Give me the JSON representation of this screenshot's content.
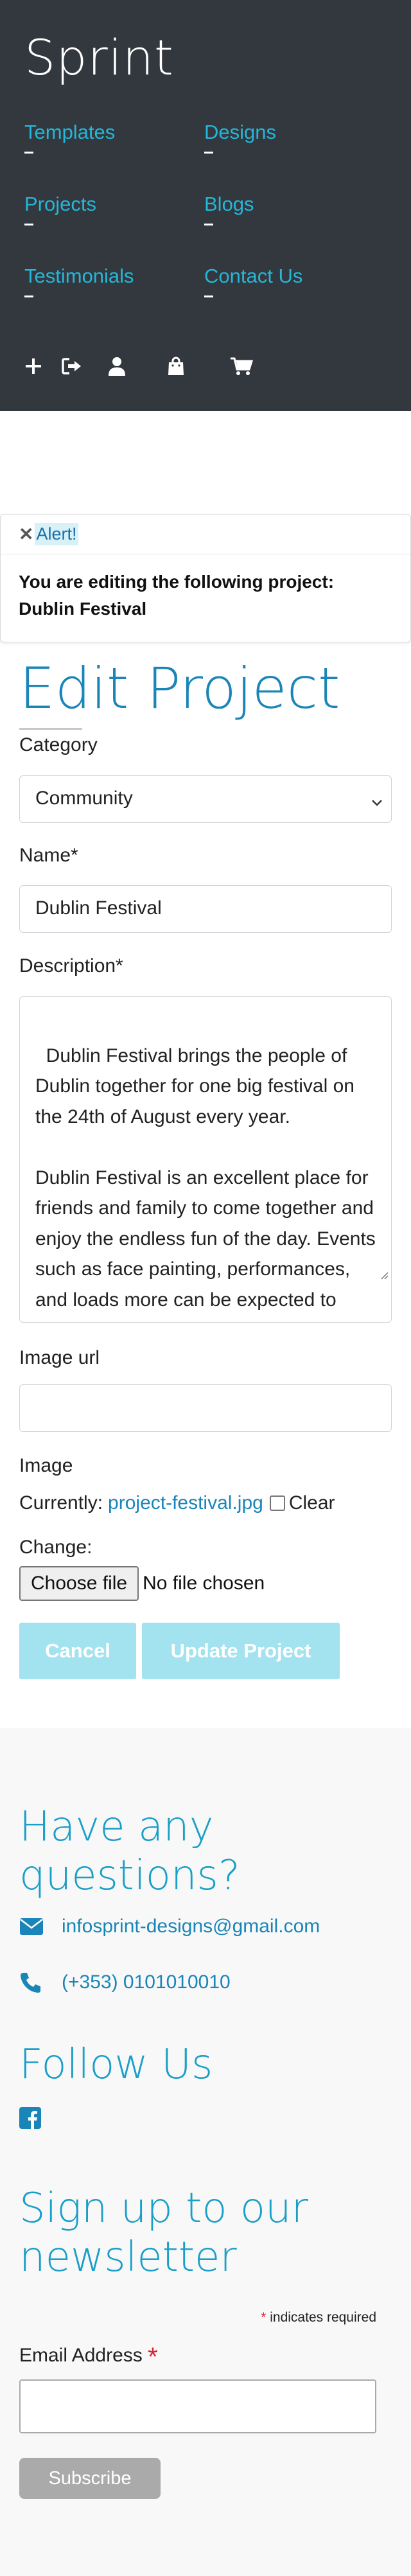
{
  "header": {
    "brand": "Sprint",
    "nav": [
      {
        "label": "Templates"
      },
      {
        "label": "Designs"
      },
      {
        "label": "Projects"
      },
      {
        "label": "Blogs"
      },
      {
        "label": "Testimonials"
      },
      {
        "label": "Contact Us"
      }
    ],
    "icons": [
      "plus-icon",
      "sign-out-icon",
      "user-icon",
      "shopping-bag-icon",
      "shopping-cart-icon"
    ]
  },
  "alert": {
    "close_symbol": "✕",
    "title": "Alert!",
    "message": "You are editing the following project: Dublin Festival"
  },
  "form": {
    "title": "Edit Project",
    "category_label": "Category",
    "category_value": "Community",
    "name_label": "Name*",
    "name_value": "Dublin Festival",
    "description_label": "Description*",
    "description_value": "Dublin Festival brings the people of Dublin together for one big festival on the 24th of August every year.\n\nDublin Festival is an excellent place for friends and family to come together and enjoy the endless fun of the day. Events such as face painting, performances, and loads more can be expected to take place at Dublin",
    "image_url_label": "Image url",
    "image_url_value": "",
    "image_label": "Image",
    "currently_label": "Currently:",
    "current_file": "project-festival.jpg",
    "clear_label": "Clear",
    "change_label": "Change:",
    "choose_file_label": "Choose file",
    "no_file_label": "No file chosen",
    "cancel_label": "Cancel",
    "update_label": "Update Project"
  },
  "footer": {
    "questions_heading": "Have any questions?",
    "email": "infosprint-designs@gmail.com",
    "phone": "(+353) 0101010010",
    "follow_heading": "Follow Us",
    "newsletter_heading": "Sign up to our newsletter",
    "required_note": "indicates required",
    "required_star": "*",
    "email_label": "Email Address",
    "subscribe_label": "Subscribe"
  },
  "colors": {
    "header_bg": "#33383e",
    "accent": "#25b6d8",
    "title_blue": "#1a85b8",
    "button_disabled": "#a3e2ef",
    "subscribe_bg": "#aaaaaa"
  }
}
